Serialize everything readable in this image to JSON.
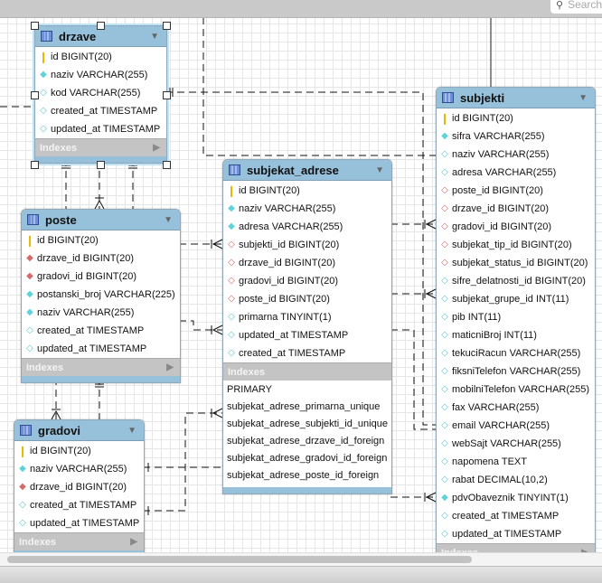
{
  "search": {
    "placeholder": "Search",
    "icon": "magnifier-icon"
  },
  "icon_legend": {
    "key": "primary-key",
    "cf": "not-null-column",
    "co": "nullable-column",
    "rf": "foreign-key-not-null",
    "ro": "foreign-key-nullable"
  },
  "colors": {
    "header": "#97c0da",
    "indexes": "#c4c4c4",
    "key": "#e8b900",
    "column": "#5fd3dc",
    "foreign_key": "#d46a6a"
  },
  "tables": [
    {
      "id": "drzave",
      "name": "drzave",
      "selected": true,
      "indexes_label": "Indexes",
      "indexes_expanded": false,
      "columns": [
        [
          "key",
          "id BIGINT(20)"
        ],
        [
          "cf",
          "naziv VARCHAR(255)"
        ],
        [
          "co",
          "kod VARCHAR(255)"
        ],
        [
          "co",
          "created_at TIMESTAMP"
        ],
        [
          "co",
          "updated_at TIMESTAMP"
        ]
      ]
    },
    {
      "id": "poste",
      "name": "poste",
      "indexes_label": "Indexes",
      "indexes_expanded": false,
      "columns": [
        [
          "key",
          "id BIGINT(20)"
        ],
        [
          "rf",
          "drzave_id BIGINT(20)"
        ],
        [
          "rf",
          "gradovi_id BIGINT(20)"
        ],
        [
          "cf",
          "postanski_broj VARCHAR(225)"
        ],
        [
          "cf",
          "naziv VARCHAR(255)"
        ],
        [
          "co",
          "created_at TIMESTAMP"
        ],
        [
          "co",
          "updated_at TIMESTAMP"
        ]
      ]
    },
    {
      "id": "gradovi",
      "name": "gradovi",
      "indexes_label": "Indexes",
      "indexes_expanded": false,
      "columns": [
        [
          "key",
          "id BIGINT(20)"
        ],
        [
          "cf",
          "naziv VARCHAR(255)"
        ],
        [
          "rf",
          "drzave_id BIGINT(20)"
        ],
        [
          "co",
          "created_at TIMESTAMP"
        ],
        [
          "co",
          "updated_at TIMESTAMP"
        ]
      ]
    },
    {
      "id": "subjekat_adrese",
      "name": "subjekat_adrese",
      "indexes_label": "Indexes",
      "indexes_expanded": true,
      "columns": [
        [
          "key",
          "id BIGINT(20)"
        ],
        [
          "cf",
          "naziv VARCHAR(255)"
        ],
        [
          "cf",
          "adresa VARCHAR(255)"
        ],
        [
          "ro",
          "subjekti_id BIGINT(20)"
        ],
        [
          "ro",
          "drzave_id BIGINT(20)"
        ],
        [
          "ro",
          "gradovi_id BIGINT(20)"
        ],
        [
          "ro",
          "poste_id BIGINT(20)"
        ],
        [
          "co",
          "primarna TINYINT(1)"
        ],
        [
          "co",
          "updated_at TIMESTAMP"
        ],
        [
          "co",
          "created_at TIMESTAMP"
        ]
      ],
      "indexes": [
        "PRIMARY",
        "subjekat_adrese_primarna_unique",
        "subjekat_adrese_subjekti_id_unique",
        "subjekat_adrese_drzave_id_foreign",
        "subjekat_adrese_gradovi_id_foreign",
        "subjekat_adrese_poste_id_foreign"
      ]
    },
    {
      "id": "subjekti",
      "name": "subjekti",
      "indexes_label": "Indexes",
      "indexes_expanded": false,
      "columns": [
        [
          "key",
          "id BIGINT(20)"
        ],
        [
          "cf",
          "sifra VARCHAR(255)"
        ],
        [
          "co",
          "naziv VARCHAR(255)"
        ],
        [
          "co",
          "adresa VARCHAR(255)"
        ],
        [
          "ro",
          "poste_id BIGINT(20)"
        ],
        [
          "ro",
          "drzave_id BIGINT(20)"
        ],
        [
          "ro",
          "gradovi_id BIGINT(20)"
        ],
        [
          "ro",
          "subjekat_tip_id BIGINT(20)"
        ],
        [
          "ro",
          "subjekat_status_id BIGINT(20)"
        ],
        [
          "co",
          "sifre_delatnosti_id BIGINT(20)"
        ],
        [
          "co",
          "subjekat_grupe_id INT(11)"
        ],
        [
          "co",
          "pib INT(11)"
        ],
        [
          "co",
          "maticniBroj INT(11)"
        ],
        [
          "co",
          "tekuciRacun VARCHAR(255)"
        ],
        [
          "co",
          "fiksniTelefon VARCHAR(255)"
        ],
        [
          "co",
          "mobilniTelefon VARCHAR(255)"
        ],
        [
          "co",
          "fax VARCHAR(255)"
        ],
        [
          "co",
          "email VARCHAR(255)"
        ],
        [
          "co",
          "webSajt VARCHAR(255)"
        ],
        [
          "co",
          "napomena TEXT"
        ],
        [
          "co",
          "rabat DECIMAL(10,2)"
        ],
        [
          "cf",
          "pdvObaveznik TINYINT(1)"
        ],
        [
          "co",
          "created_at TIMESTAMP"
        ],
        [
          "co",
          "updated_at TIMESTAMP"
        ]
      ]
    }
  ]
}
